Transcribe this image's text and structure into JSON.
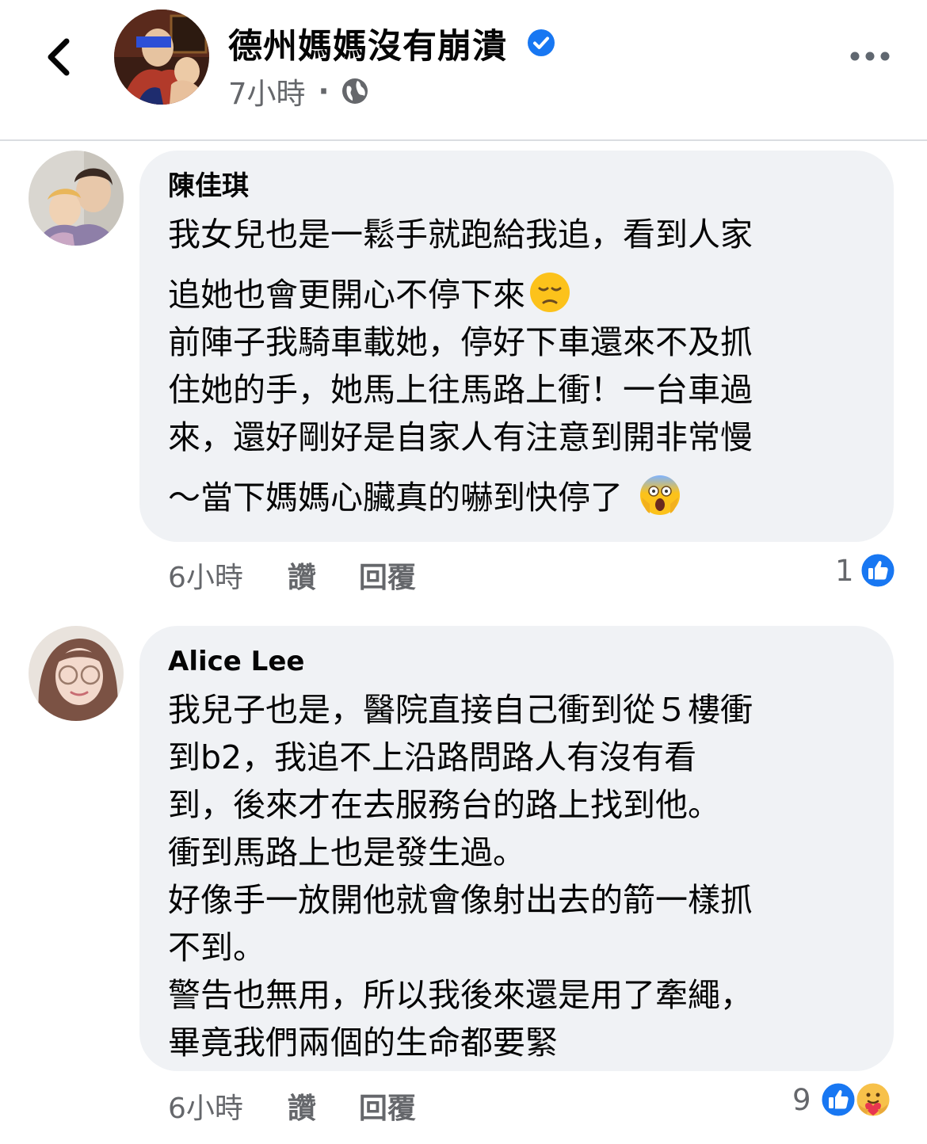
{
  "header": {
    "page_name": "德州媽媽沒有崩潰",
    "post_time": "7小時",
    "separator": "·",
    "icons": {
      "back": "chevron-left-icon",
      "verified": "verified-badge-icon",
      "privacy": "globe-icon",
      "more": "more-dots-icon"
    }
  },
  "colors": {
    "accent": "#1877f2",
    "bubble": "#f0f2f5",
    "secondary_text": "#65676b"
  },
  "comments": [
    {
      "author": "陳佳琪",
      "lines": [
        "我女兒也是一鬆手就跑給我追，看到人家",
        "追她也會更開心不停下來",
        "前陣子我騎車載她，停好下車還來不及抓",
        "住她的手，她馬上往馬路上衝！一台車過",
        "來，還好剛好是自家人有注意到開非常慢",
        "～當下媽媽心臟真的嚇到快停了"
      ],
      "emojis": [
        "pensive-face-emoji",
        "screaming-face-emoji"
      ],
      "time": "6小時",
      "like_label": "讚",
      "reply_label": "回覆",
      "reaction_count": "1",
      "reactions": [
        "like-reaction-icon"
      ]
    },
    {
      "author": "Alice Lee",
      "lines": [
        "我兒子也是，醫院直接自己衝到從５樓衝",
        "到b2，我追不上沿路問路人有沒有看",
        "到，後來才在去服務台的路上找到他。",
        "衝到馬路上也是發生過。",
        "好像手一放開他就會像射出去的箭一樣抓",
        "不到。",
        "警告也無用，所以我後來還是用了牽繩，",
        "畢竟我們兩個的生命都要緊"
      ],
      "time": "6小時",
      "like_label": "讚",
      "reply_label": "回覆",
      "reaction_count": "9",
      "reactions": [
        "like-reaction-icon",
        "care-reaction-icon"
      ]
    }
  ]
}
